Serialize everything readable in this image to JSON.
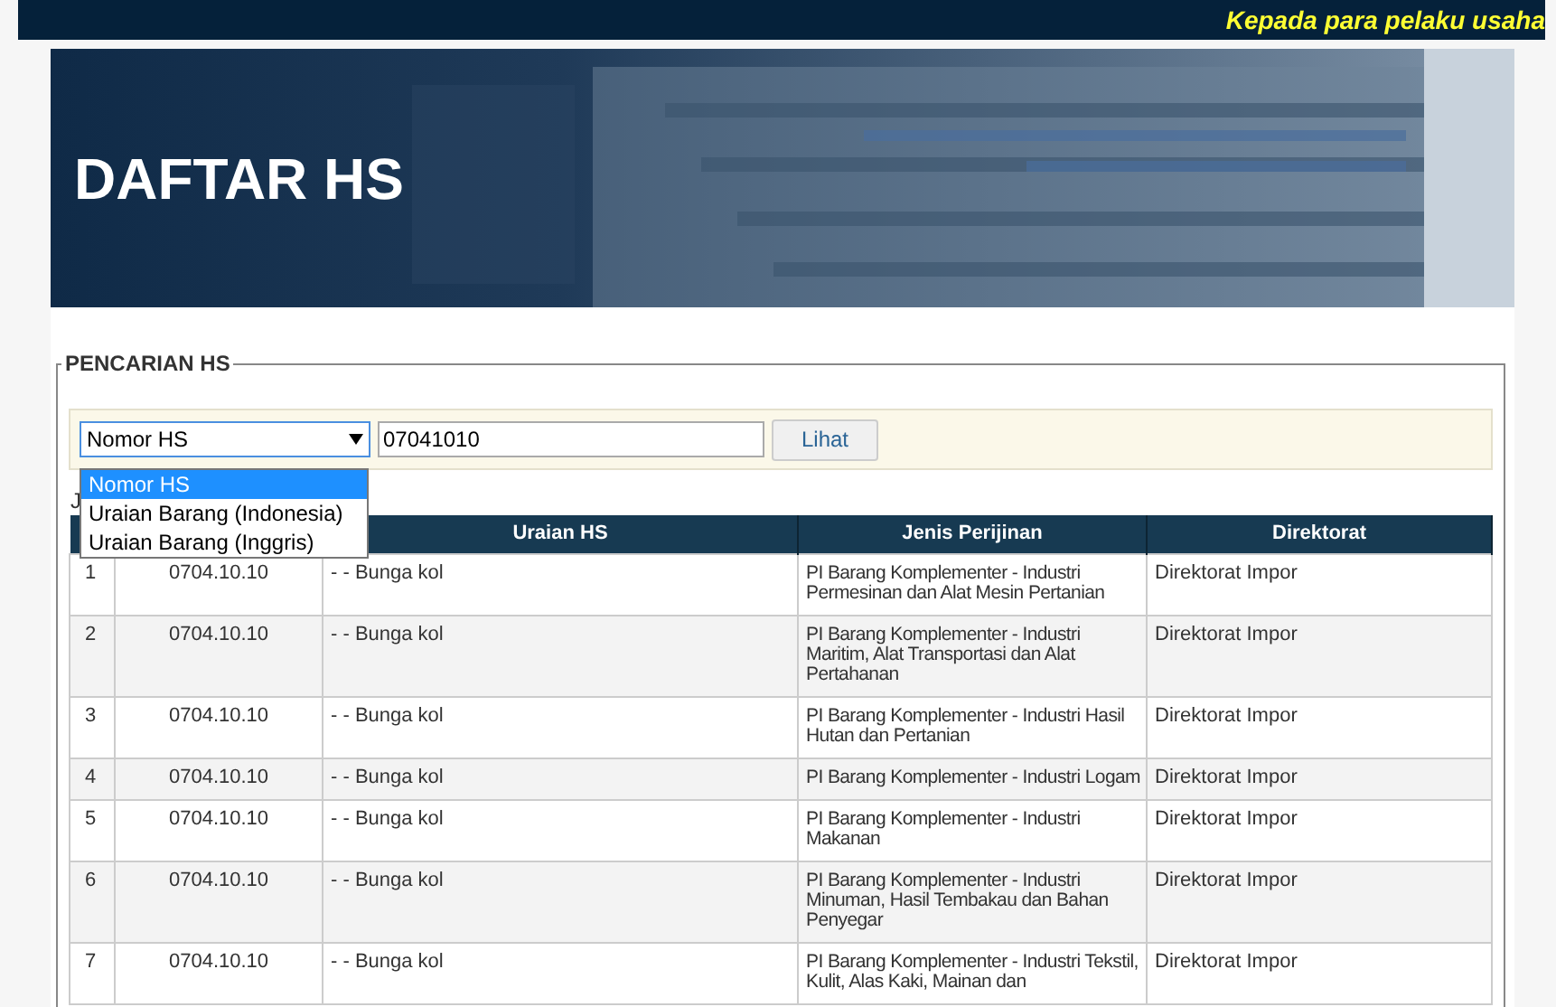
{
  "marquee": "Kepada para pelaku usaha",
  "banner": {
    "title": "DAFTAR HS"
  },
  "search": {
    "legend": "PENCARIAN HS",
    "select": {
      "value": "Nomor HS",
      "expanded": true,
      "options": [
        {
          "label": "Nomor HS",
          "selected": true
        },
        {
          "label": "Uraian Barang (Indonesia)",
          "selected": false
        },
        {
          "label": "Uraian Barang (Inggris)",
          "selected": false
        }
      ]
    },
    "query": "07041010",
    "button": "Lihat"
  },
  "result_label": "J",
  "table": {
    "columns": [
      "Uraian HS",
      "Jenis Perijinan",
      "Direktorat"
    ],
    "rows": [
      {
        "no": "1",
        "hs": "0704.10.10",
        "uraian": "- - Bunga kol",
        "jenis": "PI Barang Komplementer - Industri Permesinan dan Alat Mesin Pertanian",
        "direktorat": "Direktorat Impor"
      },
      {
        "no": "2",
        "hs": "0704.10.10",
        "uraian": "- - Bunga kol",
        "jenis": "PI Barang Komplementer - Industri Maritim, Alat Transportasi dan Alat Pertahanan",
        "direktorat": "Direktorat Impor"
      },
      {
        "no": "3",
        "hs": "0704.10.10",
        "uraian": "- - Bunga kol",
        "jenis": "PI Barang Komplementer - Industri Hasil Hutan dan Pertanian",
        "direktorat": "Direktorat Impor"
      },
      {
        "no": "4",
        "hs": "0704.10.10",
        "uraian": "- - Bunga kol",
        "jenis": "PI Barang Komplementer - Industri Logam",
        "direktorat": "Direktorat Impor"
      },
      {
        "no": "5",
        "hs": "0704.10.10",
        "uraian": "- - Bunga kol",
        "jenis": "PI Barang Komplementer - Industri Makanan",
        "direktorat": "Direktorat Impor"
      },
      {
        "no": "6",
        "hs": "0704.10.10",
        "uraian": "- - Bunga kol",
        "jenis": "PI Barang Komplementer - Industri Minuman, Hasil Tembakau dan Bahan Penyegar",
        "direktorat": "Direktorat Impor"
      },
      {
        "no": "7",
        "hs": "0704.10.10",
        "uraian": "- - Bunga kol",
        "jenis": "PI Barang Komplementer - Industri Tekstil, Kulit, Alas Kaki, Mainan dan",
        "direktorat": "Direktorat Impor"
      }
    ]
  }
}
